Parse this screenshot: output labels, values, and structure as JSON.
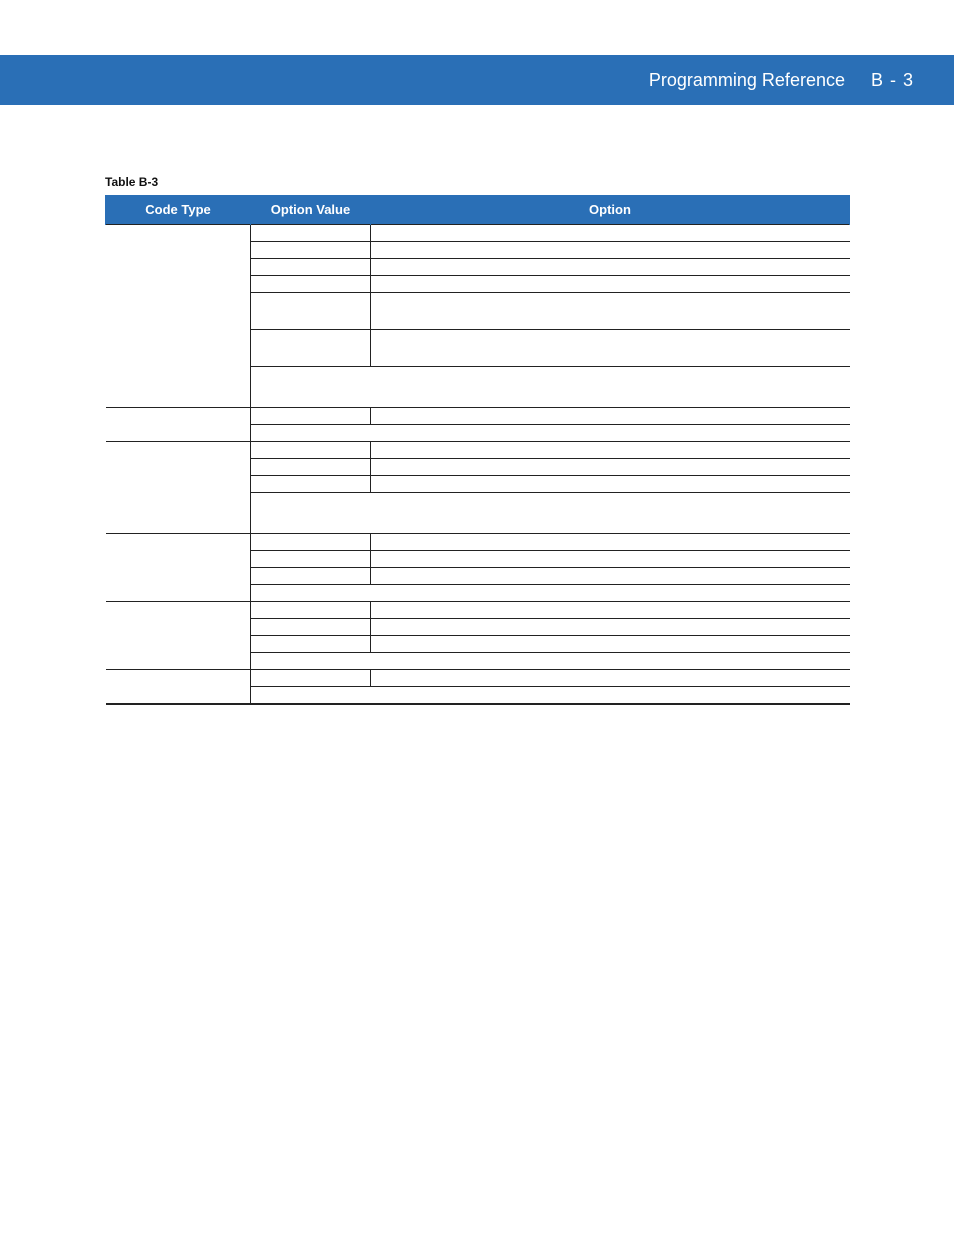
{
  "header": {
    "title": "Programming Reference",
    "pagenum": "B - 3"
  },
  "table": {
    "caption": "Table B-3",
    "headers": {
      "codetype": "Code Type",
      "optval": "Option Value",
      "option": "Option"
    },
    "rows": [
      {
        "section_start": true,
        "codetype": "",
        "optval": "",
        "option": ""
      },
      {
        "codetype": "",
        "optval": "",
        "option": ""
      },
      {
        "codetype": "",
        "optval": "",
        "option": ""
      },
      {
        "codetype": "",
        "optval": "",
        "option": ""
      },
      {
        "codetype": "",
        "optval": "",
        "option": "",
        "tall": true
      },
      {
        "codetype": "",
        "optval": "",
        "option": "",
        "tall": true
      },
      {
        "codetype": "",
        "optval": "",
        "option": "",
        "span_last_two": true,
        "xtall": true
      },
      {
        "section_start": true,
        "codetype": "",
        "optval": "",
        "option": ""
      },
      {
        "codetype": "",
        "optval": "",
        "option": "",
        "span_last_two": true
      },
      {
        "section_start": true,
        "codetype": "",
        "optval": "",
        "option": ""
      },
      {
        "codetype": "",
        "optval": "",
        "option": ""
      },
      {
        "codetype": "",
        "optval": "",
        "option": ""
      },
      {
        "codetype": "",
        "optval": "",
        "option": "",
        "span_last_two": true,
        "xtall": true
      },
      {
        "section_start": true,
        "codetype": "",
        "optval": "",
        "option": ""
      },
      {
        "codetype": "",
        "optval": "",
        "option": ""
      },
      {
        "codetype": "",
        "optval": "",
        "option": ""
      },
      {
        "codetype": "",
        "optval": "",
        "option": "",
        "span_last_two": true
      },
      {
        "section_start": true,
        "codetype": "",
        "optval": "",
        "option": ""
      },
      {
        "codetype": "",
        "optval": "",
        "option": ""
      },
      {
        "codetype": "",
        "optval": "",
        "option": ""
      },
      {
        "codetype": "",
        "optval": "",
        "option": "",
        "span_last_two": true
      },
      {
        "section_start": true,
        "codetype": "",
        "optval": "",
        "option": ""
      },
      {
        "codetype": "",
        "optval": "",
        "option": "",
        "span_last_two": true,
        "last": true
      }
    ]
  }
}
